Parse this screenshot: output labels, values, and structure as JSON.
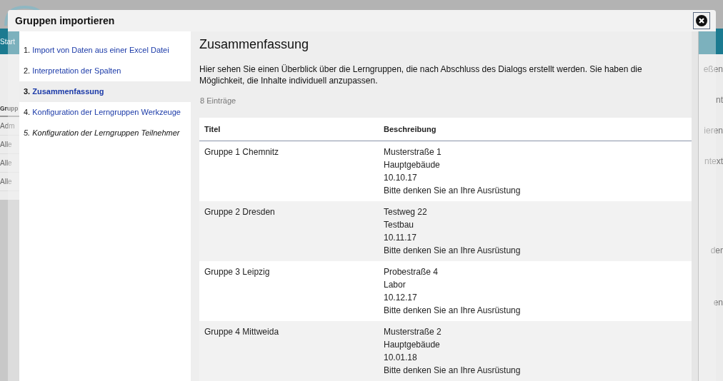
{
  "backdrop": {
    "nav_label": "Start",
    "left_heading": "Grupp",
    "left_items": [
      "Adm",
      "Alle",
      "Alle",
      "Alle"
    ],
    "right_items": [
      "eßen",
      "nt",
      "ieren",
      "ntext",
      "der",
      "en"
    ]
  },
  "dialog": {
    "title": "Gruppen importieren",
    "steps": [
      {
        "number": "1.",
        "label": "Import von Daten aus einer Excel Datei",
        "selected": false,
        "disabled": false
      },
      {
        "number": "2.",
        "label": "Interpretation der Spalten",
        "selected": false,
        "disabled": false
      },
      {
        "number": "3.",
        "label": "Zusammenfassung",
        "selected": true,
        "disabled": false
      },
      {
        "number": "4.",
        "label": "Konfiguration der Lerngruppen Werkzeuge",
        "selected": false,
        "disabled": false
      },
      {
        "number": "5.",
        "label": "Konfiguration der Lerngruppen Teilnehmer",
        "selected": false,
        "disabled": true
      }
    ],
    "heading": "Zusammenfassung",
    "intro": "Hier sehen Sie einen Überblick über die Lerngruppen, die nach Abschluss des Dialogs erstellt werden. Sie haben die Möglichkeit, die Inhalte individuell anzupassen.",
    "count": "8 Einträge",
    "table": {
      "columns": [
        "Titel",
        "Beschreibung"
      ],
      "rows": [
        {
          "title": "Gruppe 1 Chemnitz",
          "description": [
            "Musterstraße 1",
            "Hauptgebäude",
            "10.10.17",
            "Bitte denken Sie an Ihre Ausrüstung"
          ]
        },
        {
          "title": "Gruppe 2 Dresden",
          "description": [
            "Testweg 22",
            "Testbau",
            "10.11.17",
            "Bitte denken Sie an Ihre Ausrüstung"
          ]
        },
        {
          "title": "Gruppe 3 Leipzig",
          "description": [
            "Probestraße 4",
            "Labor",
            "10.12.17",
            "Bitte denken Sie an Ihre Ausrüstung"
          ]
        },
        {
          "title": "Gruppe 4 Mittweida",
          "description": [
            "Musterstraße 2",
            "Hauptgebäude",
            "10.01.18",
            "Bitte denken Sie an Ihre Ausrüstung"
          ]
        }
      ]
    }
  }
}
